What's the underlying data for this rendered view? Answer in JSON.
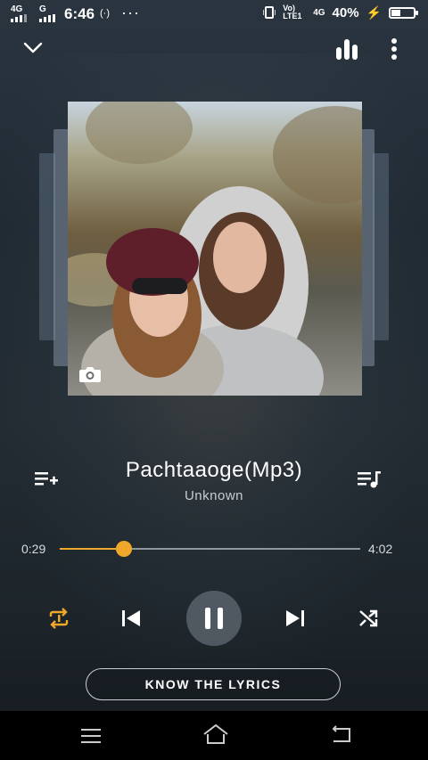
{
  "status_bar": {
    "network_1": "4G",
    "network_2": "G",
    "time": "6:46",
    "volte": "Vo) LTE1",
    "network_3": "4G",
    "battery": "40%",
    "battery_level": 0.4
  },
  "player": {
    "track_title": "Pachtaaoge(Mp3)",
    "artist": "Unknown",
    "time_elapsed": "0:29",
    "time_total": "4:02",
    "progress": 0.215,
    "lyrics_button": "KNOW THE LYRICS"
  },
  "icons": {
    "collapse": "chevron-down-icon",
    "equalizer": "equalizer-icon",
    "more": "more-vertical-icon",
    "camera": "camera-icon",
    "add_to_playlist": "playlist-add-icon",
    "queue": "queue-music-icon",
    "repeat": "repeat-one-icon",
    "previous": "skip-previous-icon",
    "pause": "pause-icon",
    "next": "skip-next-icon",
    "shuffle": "shuffle-icon"
  },
  "colors": {
    "accent": "#f0a82a",
    "background": "#1f2a33"
  }
}
